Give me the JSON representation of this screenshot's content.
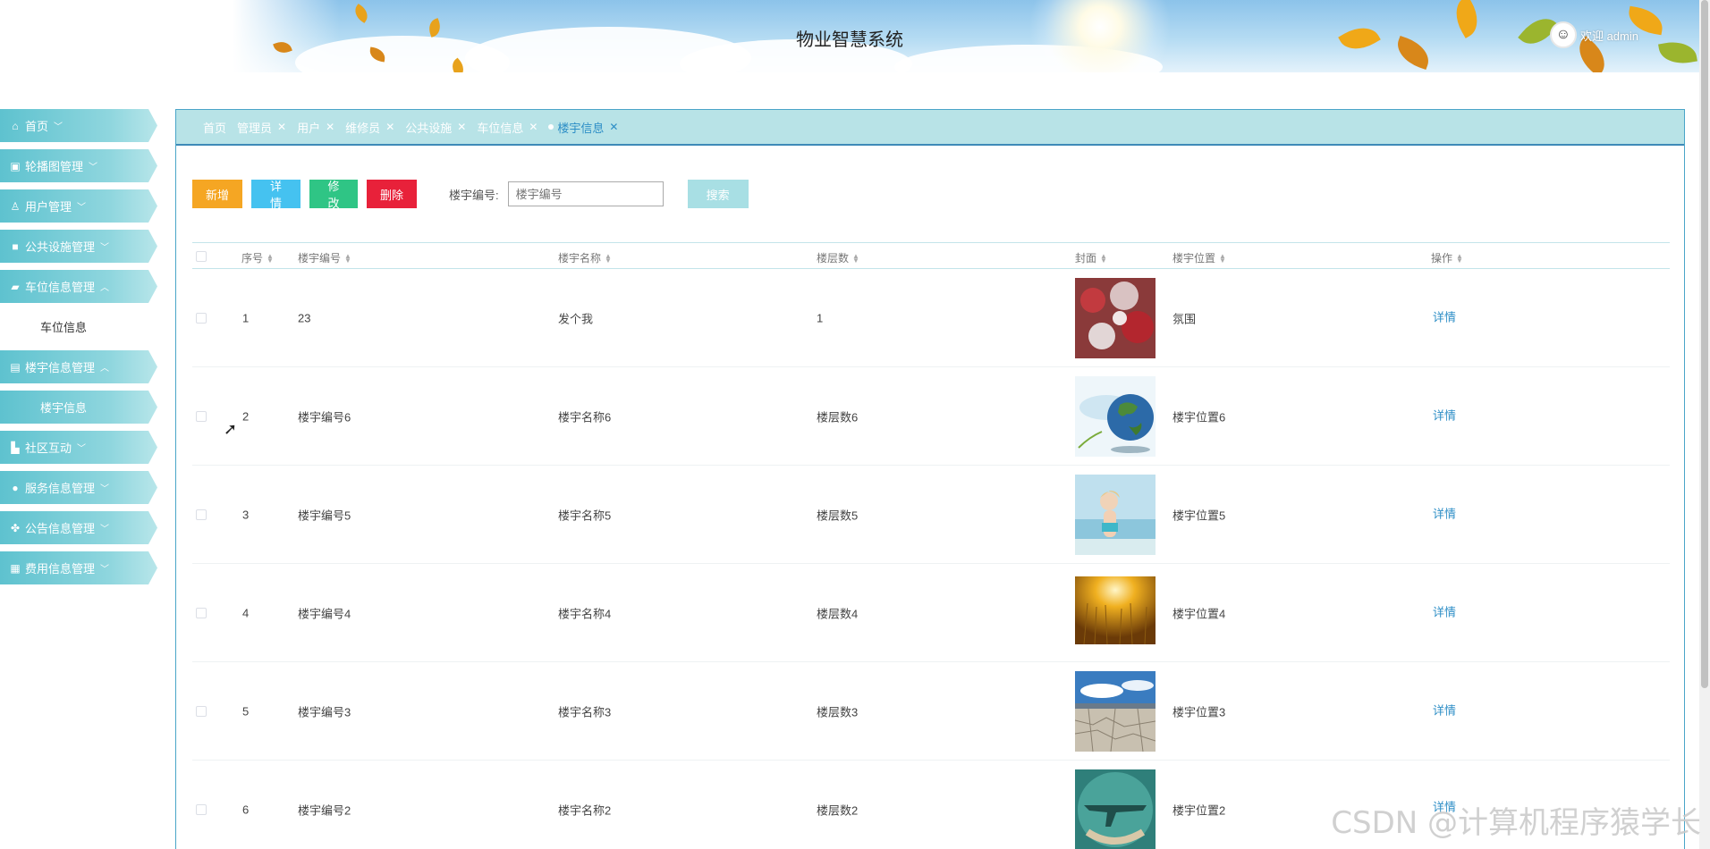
{
  "header": {
    "title": "物业智慧系统",
    "welcome": "欢迎 admin",
    "avatar_icon": "user-avatar-icon"
  },
  "sidebar": {
    "items": [
      {
        "label": "首页",
        "icon": "home-icon",
        "expanded": false
      },
      {
        "label": "轮播图管理",
        "icon": "image-icon",
        "expanded": false
      },
      {
        "label": "用户管理",
        "icon": "user-icon",
        "expanded": false
      },
      {
        "label": "公共设施管理",
        "icon": "facility-icon",
        "expanded": false
      },
      {
        "label": "车位信息管理",
        "icon": "car-icon",
        "expanded": true,
        "children": [
          "车位信息"
        ]
      },
      {
        "label": "楼宇信息管理",
        "icon": "building-icon",
        "expanded": true,
        "children": [
          "楼宇信息"
        ]
      },
      {
        "label": "社区互动",
        "icon": "chat-icon",
        "expanded": false
      },
      {
        "label": "服务信息管理",
        "icon": "service-icon",
        "expanded": false
      },
      {
        "label": "公告信息管理",
        "icon": "notice-icon",
        "expanded": false
      },
      {
        "label": "费用信息管理",
        "icon": "fee-icon",
        "expanded": false
      }
    ]
  },
  "tabs": [
    {
      "label": "首页",
      "closable": false
    },
    {
      "label": "管理员",
      "closable": true
    },
    {
      "label": "用户",
      "closable": true
    },
    {
      "label": "维修员",
      "closable": true
    },
    {
      "label": "公共设施",
      "closable": true
    },
    {
      "label": "车位信息",
      "closable": true
    },
    {
      "label": "楼宇信息",
      "closable": true,
      "active": true
    }
  ],
  "toolbar": {
    "add": "新增",
    "detail": "详情",
    "edit": "修改",
    "delete": "删除",
    "search_label": "楼宇编号:",
    "search_placeholder": "楼宇编号",
    "search_button": "搜索"
  },
  "table": {
    "columns": [
      "序号",
      "楼宇编号",
      "楼宇名称",
      "楼层数",
      "封面",
      "楼宇位置",
      "操作"
    ],
    "rows": [
      {
        "index": "1",
        "code": "23",
        "name": "发个我",
        "floors": "1",
        "location": "氛围",
        "action": "详情",
        "cover": "red-berries"
      },
      {
        "index": "2",
        "code": "楼宇编号6",
        "name": "楼宇名称6",
        "floors": "楼层数6",
        "location": "楼宇位置6",
        "action": "详情",
        "cover": "globe"
      },
      {
        "index": "3",
        "code": "楼宇编号5",
        "name": "楼宇名称5",
        "floors": "楼层数5",
        "location": "楼宇位置5",
        "action": "详情",
        "cover": "beach-child"
      },
      {
        "index": "4",
        "code": "楼宇编号4",
        "name": "楼宇名称4",
        "floors": "楼层数4",
        "location": "楼宇位置4",
        "action": "详情",
        "cover": "wheat-sunset"
      },
      {
        "index": "5",
        "code": "楼宇编号3",
        "name": "楼宇名称3",
        "floors": "楼层数3",
        "location": "楼宇位置3",
        "action": "详情",
        "cover": "cracked-desert"
      },
      {
        "index": "6",
        "code": "楼宇编号2",
        "name": "楼宇名称2",
        "floors": "楼层数2",
        "location": "楼宇位置2",
        "action": "详情",
        "cover": "plane-shadow"
      }
    ]
  },
  "watermark": "CSDN @计算机程序猿学长",
  "colors": {
    "accent": "#5ec2cf",
    "tab_bar": "#b8e3e7",
    "link": "#2d8ec6",
    "btn_add": "#f5a623",
    "btn_detail": "#45c2f0",
    "btn_edit": "#2fc585",
    "btn_delete": "#e8213a"
  }
}
